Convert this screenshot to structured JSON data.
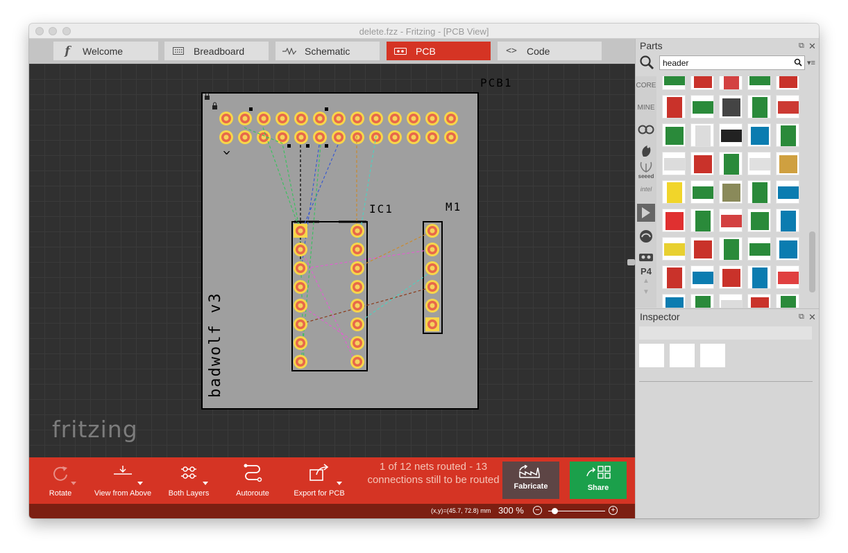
{
  "window": {
    "title": "delete.fzz - Fritzing - [PCB View]"
  },
  "tabs": [
    {
      "label": "Welcome",
      "icon": "fritzing-f-icon"
    },
    {
      "label": "Breadboard",
      "icon": "breadboard-icon"
    },
    {
      "label": "Schematic",
      "icon": "resistor-icon"
    },
    {
      "label": "PCB",
      "icon": "pcb-icon",
      "active": true
    },
    {
      "label": "Code",
      "icon": "code-brackets-icon"
    }
  ],
  "canvas": {
    "board_label": "PCB1",
    "ic_label": "IC1",
    "motor_label": "M1",
    "silkscreen_text": "badwolf v3",
    "header_marker": "^",
    "logo": "fritzing"
  },
  "toolbar": {
    "rotate": "Rotate",
    "view_from_above": "View from Above",
    "both_layers": "Both Layers",
    "autoroute": "Autoroute",
    "export_pcb": "Export for PCB",
    "routing_status": "1 of 12 nets routed - 13 connections still to be routed",
    "fabricate": "Fabricate",
    "share": "Share"
  },
  "status": {
    "coordinates": "(x,y)=(45.7, 72.8) mm",
    "zoom": "300 %"
  },
  "parts": {
    "title": "Parts",
    "search_value": "header",
    "bins": [
      "CORE",
      "MINE",
      "seeed",
      "intel",
      "P4"
    ]
  },
  "inspector": {
    "title": "Inspector"
  },
  "colors": {
    "accent": "#d53424",
    "share": "#1ba04b",
    "fabricate": "#5d4545",
    "status": "#7c1f12"
  }
}
